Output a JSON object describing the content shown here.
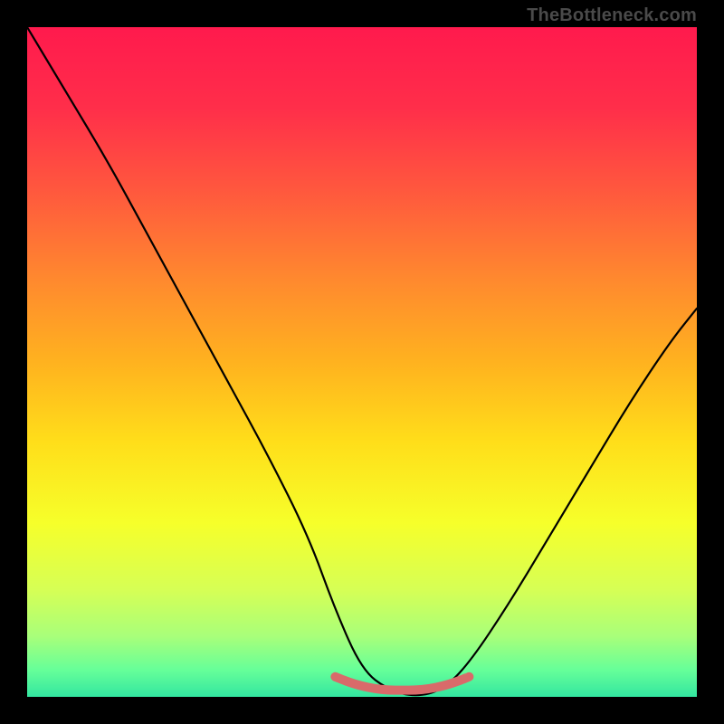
{
  "watermark": "TheBottleneck.com",
  "gradient": {
    "stops": [
      {
        "offset": 0.0,
        "color": "#ff1a4d"
      },
      {
        "offset": 0.12,
        "color": "#ff2e4a"
      },
      {
        "offset": 0.25,
        "color": "#ff5a3d"
      },
      {
        "offset": 0.38,
        "color": "#ff8a2e"
      },
      {
        "offset": 0.5,
        "color": "#ffb21f"
      },
      {
        "offset": 0.62,
        "color": "#ffde1a"
      },
      {
        "offset": 0.74,
        "color": "#f6ff2a"
      },
      {
        "offset": 0.84,
        "color": "#d6ff55"
      },
      {
        "offset": 0.91,
        "color": "#a8ff7a"
      },
      {
        "offset": 0.96,
        "color": "#66ff99"
      },
      {
        "offset": 1.0,
        "color": "#33e6a0"
      }
    ]
  },
  "chart_data": {
    "type": "line",
    "title": "",
    "xlabel": "",
    "ylabel": "",
    "xlim": [
      0,
      100
    ],
    "ylim": [
      0,
      100
    ],
    "series": [
      {
        "name": "bottleneck-curve",
        "x": [
          0,
          6,
          12,
          18,
          24,
          30,
          36,
          42,
          46,
          50,
          54,
          58,
          62,
          66,
          72,
          78,
          84,
          90,
          96,
          100
        ],
        "values": [
          100,
          90,
          80,
          69,
          58,
          47,
          36,
          24,
          13,
          4,
          1,
          0,
          1,
          5,
          14,
          24,
          34,
          44,
          53,
          58
        ]
      },
      {
        "name": "bottom-band-thick",
        "x": [
          46,
          48,
          50,
          52,
          54,
          56,
          58,
          60,
          62,
          64,
          66
        ],
        "values": [
          3,
          2.2,
          1.6,
          1.2,
          1.0,
          1.0,
          1.0,
          1.2,
          1.6,
          2.2,
          3
        ]
      }
    ]
  }
}
